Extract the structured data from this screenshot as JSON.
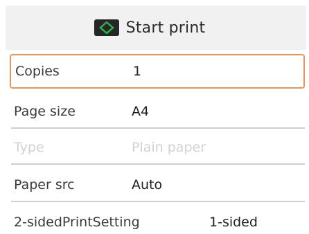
{
  "header": {
    "icon": "start-diamond-icon",
    "icon_color": "#2bb34a",
    "label": "Start print"
  },
  "settings": [
    {
      "label": "Copies",
      "value": "1",
      "state": "selected"
    },
    {
      "label": "Page size",
      "value": "A4",
      "state": "normal"
    },
    {
      "label": "Type",
      "value": "Plain paper",
      "state": "disabled"
    },
    {
      "label": "Paper src",
      "value": "Auto",
      "state": "normal"
    },
    {
      "label": "2-sidedPrintSetting",
      "value": "1-sided",
      "state": "normal"
    }
  ],
  "colors": {
    "selection_border": "#e8955c",
    "header_background": "#f1f1f1",
    "disabled_text": "#d2d2d2"
  }
}
